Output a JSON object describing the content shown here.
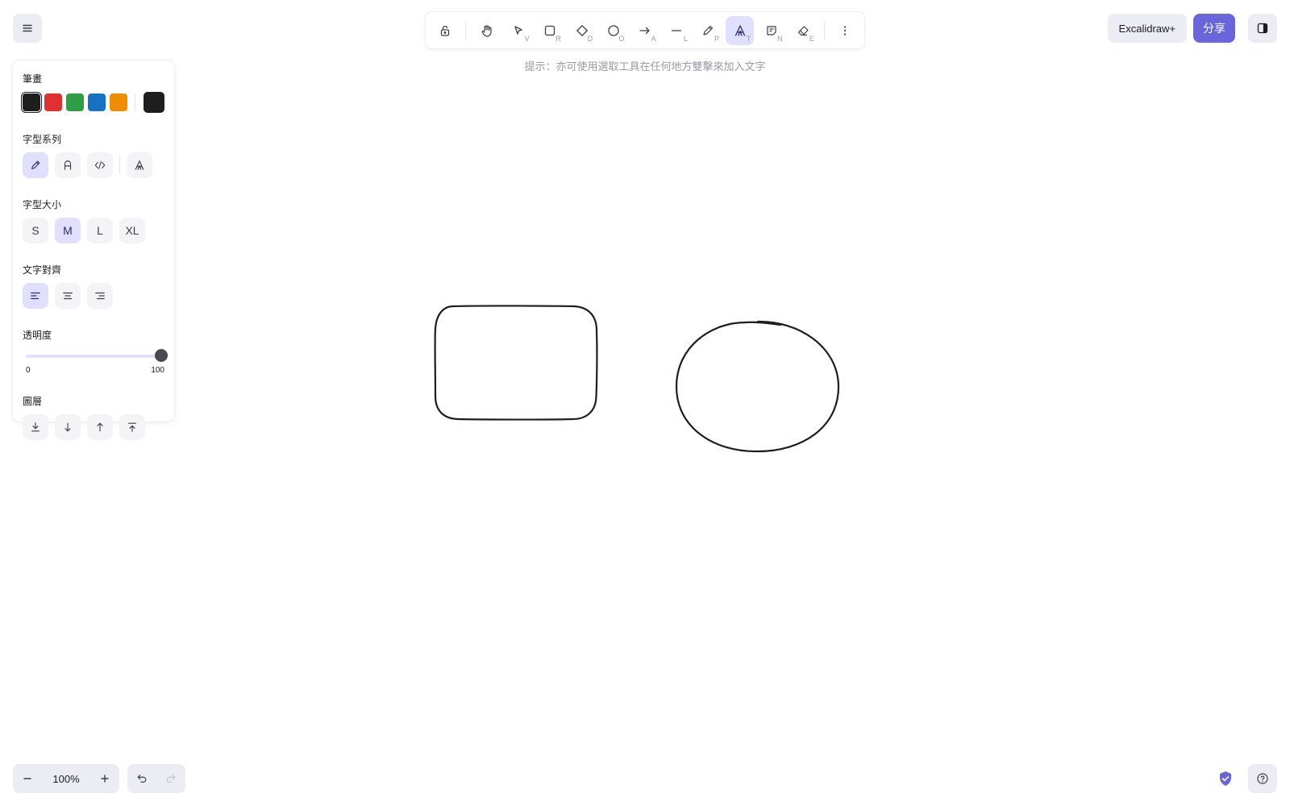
{
  "app": {
    "theme_accent": "#6965db",
    "active_tool_bg": "#e0dfff"
  },
  "menu": {
    "icon": "hamburger-icon"
  },
  "toolbar": {
    "tools": [
      {
        "name": "lock",
        "icon": "lock-open-icon",
        "key": ""
      },
      {
        "name": "hand",
        "icon": "hand-icon",
        "key": ""
      },
      {
        "name": "selection",
        "icon": "pointer-icon",
        "key": "V"
      },
      {
        "name": "rectangle",
        "icon": "rectangle-icon",
        "key": "R"
      },
      {
        "name": "diamond",
        "icon": "diamond-icon",
        "key": "D"
      },
      {
        "name": "ellipse",
        "icon": "ellipse-icon",
        "key": "O"
      },
      {
        "name": "arrow",
        "icon": "arrow-icon",
        "key": "A"
      },
      {
        "name": "line",
        "icon": "line-icon",
        "key": "L"
      },
      {
        "name": "draw",
        "icon": "pencil-icon",
        "key": "P"
      },
      {
        "name": "text",
        "icon": "text-icon",
        "key": "T",
        "active": true
      },
      {
        "name": "image",
        "icon": "note-icon",
        "key": "N"
      },
      {
        "name": "eraser",
        "icon": "eraser-icon",
        "key": "E"
      },
      {
        "name": "more",
        "icon": "more-vertical-icon",
        "key": ""
      }
    ]
  },
  "hint": "提示：亦可使用選取工具在任何地方雙擊來加入文字",
  "top_right": {
    "plus_label": "Excalidraw+",
    "share_label": "分享"
  },
  "panel": {
    "stroke": {
      "title": "筆畫",
      "colors": [
        "#1e1e1e",
        "#e03131",
        "#2f9e44",
        "#1971c2",
        "#f08c00"
      ],
      "selected": "#1e1e1e"
    },
    "font_family": {
      "title": "字型系列",
      "options": [
        "hand-drawn",
        "normal",
        "code",
        "font-picker"
      ],
      "active": "hand-drawn"
    },
    "font_size": {
      "title": "字型大小",
      "options": [
        "S",
        "M",
        "L",
        "XL"
      ],
      "active": "M"
    },
    "text_align": {
      "title": "文字對齊",
      "options": [
        "left",
        "center",
        "right"
      ],
      "active": "left"
    },
    "opacity": {
      "title": "透明度",
      "min_label": "0",
      "max_label": "100",
      "value": 100
    },
    "layers": {
      "title": "圖層",
      "options": [
        "send-to-back",
        "send-backward",
        "bring-forward",
        "bring-to-front"
      ]
    }
  },
  "canvas": {
    "shapes": [
      "rounded-rectangle",
      "ellipse"
    ]
  },
  "footer": {
    "zoom_label": "100%"
  }
}
